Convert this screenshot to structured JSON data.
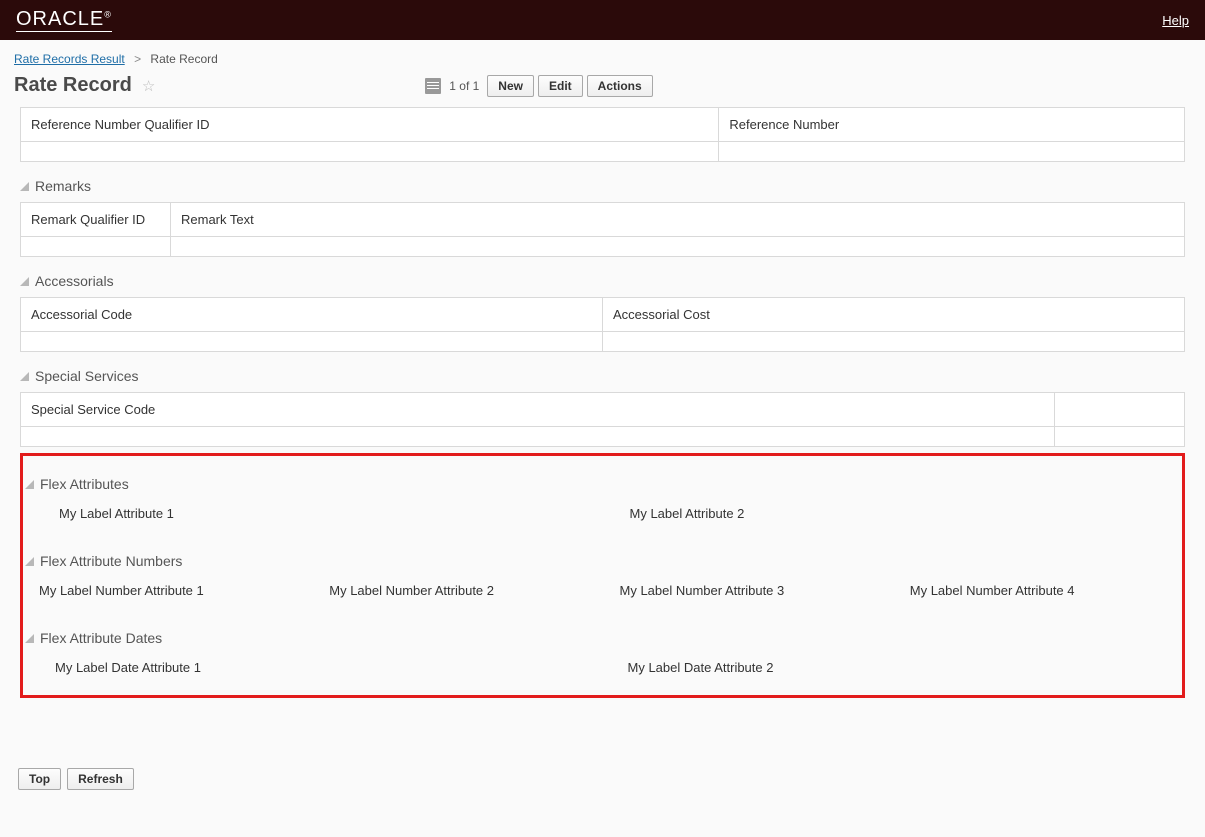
{
  "header": {
    "brand": "ORACLE",
    "help": "Help"
  },
  "breadcrumb": {
    "parent": "Rate Records Result",
    "current": "Rate Record"
  },
  "page": {
    "title": "Rate Record",
    "record_count": "1 of 1"
  },
  "toolbar": {
    "new": "New",
    "edit": "Edit",
    "actions": "Actions"
  },
  "tables": {
    "ref_qual_id": "Reference Number Qualifier ID",
    "ref_num": "Reference Number",
    "remark_qual_id": "Remark Qualifier ID",
    "remark_text": "Remark Text",
    "accessorial_code": "Accessorial Code",
    "accessorial_cost": "Accessorial Cost",
    "special_service_code": "Special Service Code"
  },
  "sections": {
    "remarks": "Remarks",
    "accessorials": "Accessorials",
    "special_services": "Special Services",
    "flex_attributes": "Flex Attributes",
    "flex_attribute_numbers": "Flex Attribute Numbers",
    "flex_attribute_dates": "Flex Attribute Dates"
  },
  "flex": {
    "attr1": "My Label Attribute 1",
    "attr2": "My Label Attribute 2",
    "num1": "My Label Number Attribute 1",
    "num2": "My Label Number Attribute 2",
    "num3": "My Label Number Attribute 3",
    "num4": "My Label Number Attribute 4",
    "date1": "My Label Date Attribute 1",
    "date2": "My Label Date Attribute 2"
  },
  "footer": {
    "top": "Top",
    "refresh": "Refresh"
  }
}
